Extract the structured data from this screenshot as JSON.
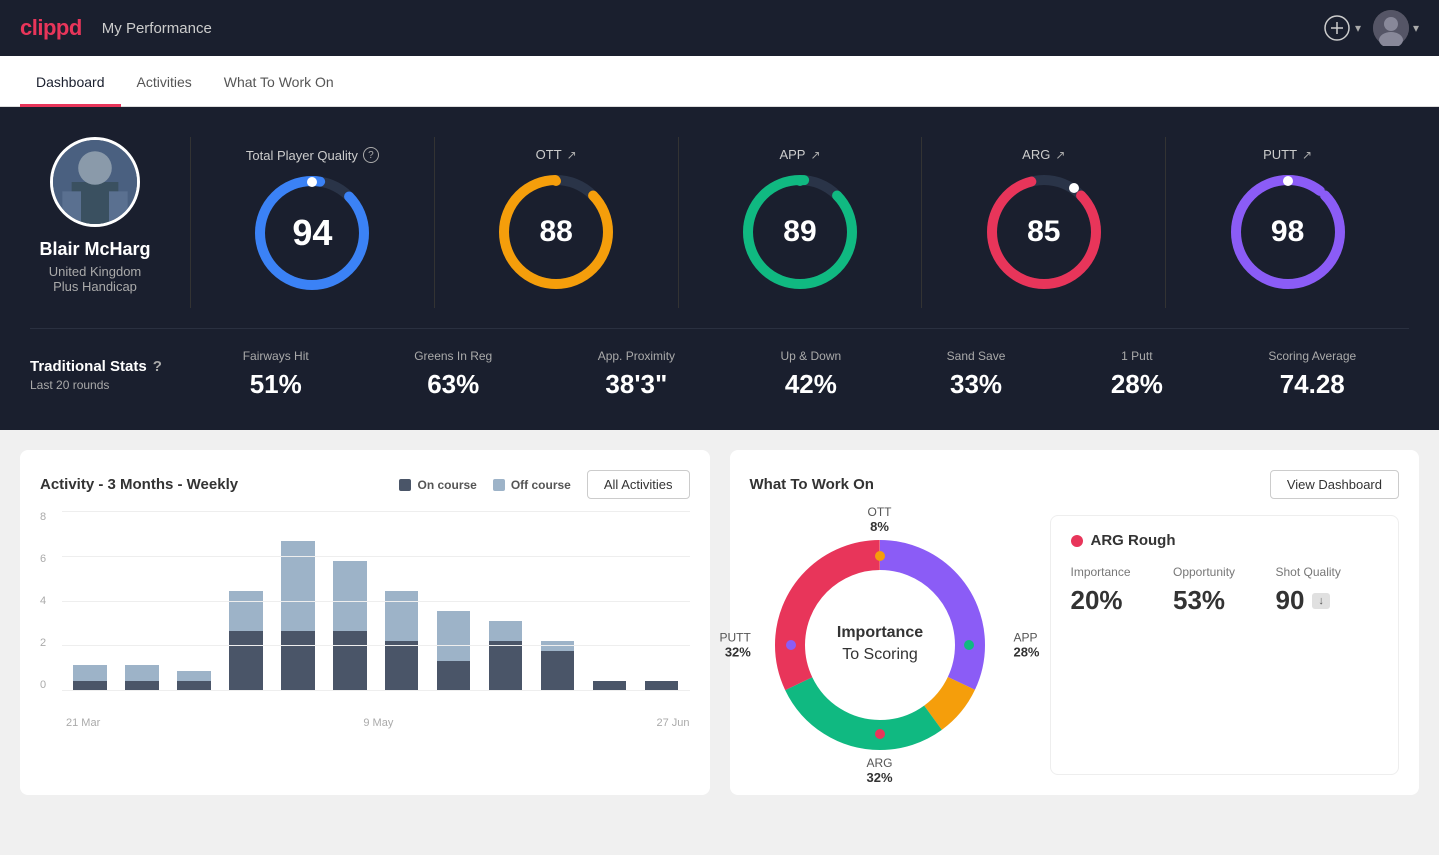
{
  "header": {
    "logo": "clippd",
    "title": "My Performance",
    "add_button_label": "⊕",
    "avatar_chevron": "▾"
  },
  "nav": {
    "tabs": [
      {
        "id": "dashboard",
        "label": "Dashboard",
        "active": true
      },
      {
        "id": "activities",
        "label": "Activities",
        "active": false
      },
      {
        "id": "what-to-work-on",
        "label": "What To Work On",
        "active": false
      }
    ]
  },
  "player": {
    "name": "Blair McHarg",
    "country": "United Kingdom",
    "handicap": "Plus Handicap"
  },
  "quality": {
    "total": {
      "label": "Total Player Quality",
      "value": 94,
      "color": "#3b82f6"
    },
    "ott": {
      "label": "OTT",
      "value": 88,
      "color": "#f59e0b",
      "arrow": "↗"
    },
    "app": {
      "label": "APP",
      "value": 89,
      "color": "#10b981",
      "arrow": "↗"
    },
    "arg": {
      "label": "ARG",
      "value": 85,
      "color": "#e8355a",
      "arrow": "↗"
    },
    "putt": {
      "label": "PUTT",
      "value": 98,
      "color": "#8b5cf6",
      "arrow": "↗"
    }
  },
  "traditional_stats": {
    "title": "Traditional Stats",
    "subtitle": "Last 20 rounds",
    "help": "?",
    "stats": [
      {
        "label": "Fairways Hit",
        "value": "51%"
      },
      {
        "label": "Greens In Reg",
        "value": "63%"
      },
      {
        "label": "App. Proximity",
        "value": "38'3\""
      },
      {
        "label": "Up & Down",
        "value": "42%"
      },
      {
        "label": "Sand Save",
        "value": "33%"
      },
      {
        "label": "1 Putt",
        "value": "28%"
      },
      {
        "label": "Scoring Average",
        "value": "74.28"
      }
    ]
  },
  "activity_chart": {
    "title": "Activity - 3 Months - Weekly",
    "legend": {
      "on_course": "On course",
      "off_course": "Off course"
    },
    "all_activities_btn": "All Activities",
    "y_labels": [
      "0",
      "2",
      "4",
      "6",
      "8"
    ],
    "x_labels": [
      "21 Mar",
      "9 May",
      "27 Jun"
    ],
    "bars": [
      {
        "on": 0.5,
        "off": 0.8
      },
      {
        "on": 0.5,
        "off": 0.8
      },
      {
        "on": 0.5,
        "off": 0.5
      },
      {
        "on": 3.0,
        "off": 2.0
      },
      {
        "on": 3.0,
        "off": 4.5
      },
      {
        "on": 3.0,
        "off": 3.5
      },
      {
        "on": 2.5,
        "off": 2.5
      },
      {
        "on": 1.5,
        "off": 2.5
      },
      {
        "on": 2.5,
        "off": 1.0
      },
      {
        "on": 2.0,
        "off": 0.5
      },
      {
        "on": 0.5,
        "off": 0
      },
      {
        "on": 0.5,
        "off": 0
      }
    ]
  },
  "what_to_work_on": {
    "title": "What To Work On",
    "view_dashboard_btn": "View Dashboard",
    "center_label_line1": "Importance",
    "center_label_line2": "To Scoring",
    "segments": [
      {
        "label": "OTT",
        "pct": "8%",
        "color": "#f59e0b",
        "position": "top"
      },
      {
        "label": "APP",
        "pct": "28%",
        "color": "#10b981",
        "position": "right"
      },
      {
        "label": "ARG",
        "pct": "32%",
        "color": "#e8355a",
        "position": "bottom"
      },
      {
        "label": "PUTT",
        "pct": "32%",
        "color": "#8b5cf6",
        "position": "left"
      }
    ],
    "arg_card": {
      "title": "ARG Rough",
      "dot_color": "#e8355a",
      "stats": [
        {
          "label": "Importance",
          "value": "20%"
        },
        {
          "label": "Opportunity",
          "value": "53%"
        },
        {
          "label": "Shot Quality",
          "value": "90",
          "badge": "↓"
        }
      ]
    }
  }
}
